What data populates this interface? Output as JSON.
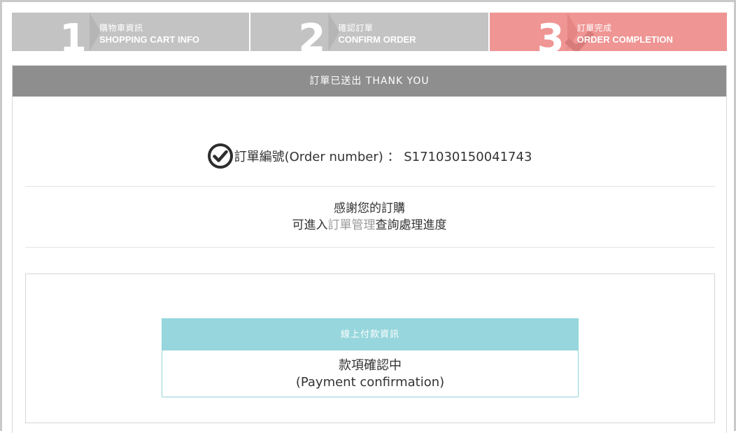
{
  "steps": [
    {
      "number": "1",
      "zh": "購物車資訊",
      "en": "SHOPPING CART INFO",
      "active": false
    },
    {
      "number": "2",
      "zh": "確認訂單",
      "en": "CONFIRM ORDER",
      "active": false
    },
    {
      "number": "3",
      "zh": "訂單完成",
      "en": "ORDER COMPLETION",
      "active": true
    }
  ],
  "header": {
    "title": "訂單已送出 THANK YOU"
  },
  "order": {
    "label": "訂單編號(Order number)",
    "separator": " ： ",
    "value": "S171030150041743"
  },
  "thanks": {
    "line1": "感謝您的訂購",
    "prefix": "可進入",
    "link": "訂單管理",
    "suffix": "查詢處理進度"
  },
  "payment": {
    "title": "線上付款資訊",
    "status_zh": "款項確認中",
    "status_en": "(Payment confirmation)"
  },
  "colors": {
    "step_inactive": "#c3c3c3",
    "step_active": "#ef9594",
    "header_bg": "#8e8e8e",
    "payment_bg": "#96d6dc",
    "link": "#9a9a9a"
  },
  "icons": {
    "order_check": "check-circle-icon"
  }
}
